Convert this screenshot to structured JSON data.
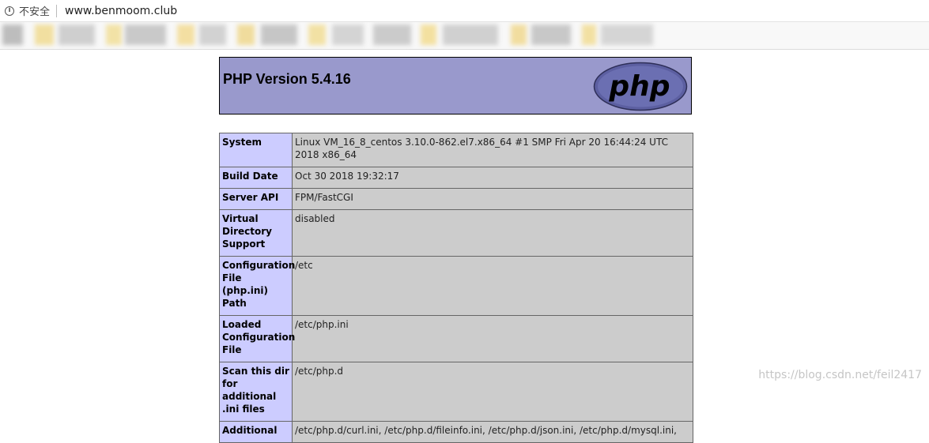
{
  "browser": {
    "security_label": "不安全",
    "url": "www.benmoom.club"
  },
  "page": {
    "title": "PHP Version 5.4.16",
    "logo_text": "php"
  },
  "rows": [
    {
      "key": "System",
      "value": "Linux VM_16_8_centos 3.10.0-862.el7.x86_64 #1 SMP Fri Apr 20 16:44:24 UTC 2018 x86_64"
    },
    {
      "key": "Build Date",
      "value": "Oct 30 2018 19:32:17"
    },
    {
      "key": "Server API",
      "value": "FPM/FastCGI"
    },
    {
      "key": "Virtual Directory Support",
      "value": "disabled"
    },
    {
      "key": "Configuration File (php.ini) Path",
      "value": "/etc"
    },
    {
      "key": "Loaded Configuration File",
      "value": "/etc/php.ini"
    },
    {
      "key": "Scan this dir for additional .ini files",
      "value": "/etc/php.d"
    },
    {
      "key": "Additional",
      "value": "/etc/php.d/curl.ini, /etc/php.d/fileinfo.ini, /etc/php.d/json.ini, /etc/php.d/mysql.ini,"
    }
  ],
  "watermark": "https://blog.csdn.net/feil2417",
  "colors": {
    "header_bg": "#9999cc",
    "key_cell_bg": "#ccccff",
    "value_cell_bg": "#cccccc"
  }
}
